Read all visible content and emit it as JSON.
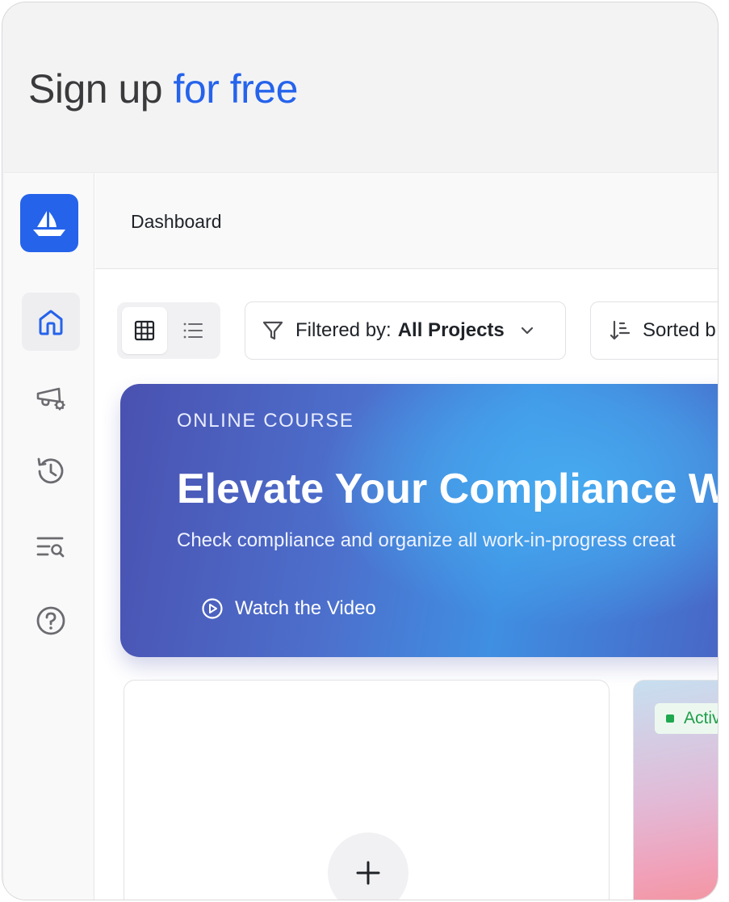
{
  "headline": {
    "prefix": "Sign up",
    "accent": "for free"
  },
  "colors": {
    "accent": "#2563eb",
    "banner_start": "#4a51b0",
    "banner_glow": "#46a9ef",
    "status_green": "#1f9d4a"
  },
  "sidebar": {
    "logo": "boat-logo",
    "items": [
      {
        "icon": "home-icon",
        "label": "Home",
        "active": true
      },
      {
        "icon": "campaign-settings-icon",
        "label": "Campaigns",
        "active": false
      },
      {
        "icon": "history-icon",
        "label": "History",
        "active": false
      },
      {
        "icon": "search-list-icon",
        "label": "Search",
        "active": false
      },
      {
        "icon": "help-icon",
        "label": "Help",
        "active": false
      }
    ]
  },
  "topbar": {
    "title": "Dashboard"
  },
  "toolbar": {
    "view_modes": [
      "grid",
      "list"
    ],
    "selected_view": "grid",
    "filter": {
      "prefix": "Filtered by:",
      "value": "All Projects"
    },
    "sort": {
      "prefix": "Sorted b"
    }
  },
  "banner": {
    "eyebrow": "ONLINE COURSE",
    "title": "Elevate Your Compliance W",
    "subtitle": "Check compliance and organize all work-in-progress creat",
    "cta": "Watch the Video"
  },
  "cards": {
    "new_project": {
      "icon": "plus-icon"
    },
    "project": {
      "status": "Activ"
    }
  }
}
